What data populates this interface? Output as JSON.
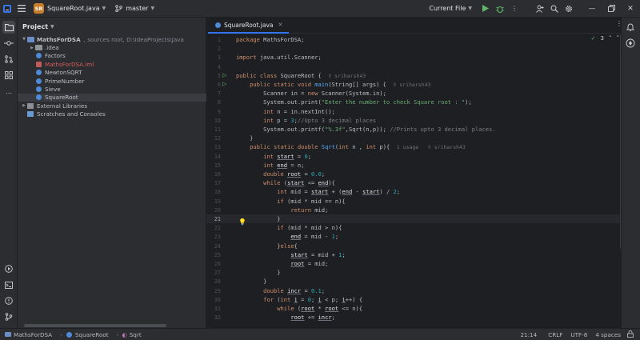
{
  "titlebar": {
    "project_badge": "SR",
    "file": "SquareRoot.java",
    "branch": "master",
    "run_config": "Current File"
  },
  "project_panel": {
    "title": "Project",
    "tree": [
      {
        "label": "MathsForDSA",
        "detail": "MathsForDSA,  sources root,  D:\\IdeaProjects\\Java",
        "type": "module",
        "indent": 1,
        "expanded": true
      },
      {
        "label": ".idea",
        "type": "folder",
        "indent": 2,
        "expanded": false
      },
      {
        "label": "Factors",
        "type": "class",
        "indent": 2
      },
      {
        "label": "MathsForDSA.iml",
        "type": "iml",
        "indent": 2
      },
      {
        "label": "NewtonSQRT",
        "type": "class",
        "indent": 2
      },
      {
        "label": "PrimeNumber",
        "type": "class",
        "indent": 2
      },
      {
        "label": "Sieve",
        "type": "class",
        "indent": 2
      },
      {
        "label": "SquareRoot",
        "type": "class",
        "indent": 2,
        "selected": true
      },
      {
        "label": "External Libraries",
        "type": "lib",
        "indent": 1,
        "expanded": false
      },
      {
        "label": "Scratches and Consoles",
        "type": "scratch",
        "indent": 1
      }
    ]
  },
  "editor": {
    "tab_label": "SquareRoot.java",
    "inspection_count": "3",
    "current_line": 21,
    "lines": [
      {
        "n": "1",
        "html": "<span class='kw'>package</span> MathsForDSA;"
      },
      {
        "n": "2",
        "html": ""
      },
      {
        "n": "3",
        "html": "<span class='kw'>import</span> java.util.Scanner;"
      },
      {
        "n": "4",
        "html": ""
      },
      {
        "n": "5",
        "html": "<span class='kw'>public class</span> SquareRoot {  <span class='hint'>♀ sriharsh43</span>",
        "run": true
      },
      {
        "n": "6",
        "html": "    <span class='kw'>public static void</span> <span class='fn'>main</span>(String[] args) {  <span class='hint'>♀ sriharsh43</span>",
        "run": true
      },
      {
        "n": "7",
        "html": "        Scanner in = <span class='kw'>new</span> Scanner(System.in);"
      },
      {
        "n": "8",
        "html": "        System.out.print(<span class='str'>\"Enter the number to check Square root : \"</span>);"
      },
      {
        "n": "9",
        "html": "        <span class='kw'>int</span> n = in.nextInt();"
      },
      {
        "n": "10",
        "html": "        <span class='kw'>int</span> p = <span class='num'>3</span>;<span class='cm'>//Upto 3 decimal places</span>"
      },
      {
        "n": "11",
        "html": "        System.out.printf(<span class='str'>\"%.3f\"</span>,Sqrt(n,p)); <span class='cm'>//Prints upto 3 decimal places.</span>"
      },
      {
        "n": "12",
        "html": "    }"
      },
      {
        "n": "13",
        "html": "    <span class='kw'>public static double</span> <span class='fn'>Sqrt</span>(<span class='kw'>int</span> n , <span class='kw'>int</span> p){  <span class='hint'>1 usage   ♀ sriharsh43</span>"
      },
      {
        "n": "14",
        "html": "        <span class='kw'>int</span> <span class='var'>start</span> = <span class='num'>0</span>;"
      },
      {
        "n": "15",
        "html": "        <span class='kw'>int</span> <span class='var'>end</span> = n;"
      },
      {
        "n": "16",
        "html": "        <span class='kw'>double</span> <span class='var'>root</span> = <span class='num'>0.0</span>;"
      },
      {
        "n": "17",
        "html": "        <span class='kw'>while</span> (<span class='var'>start</span> &lt;= <span class='var'>end</span>){"
      },
      {
        "n": "18",
        "html": "            <span class='kw'>int</span> mid = <span class='var'>start</span> + (<span class='var'>end</span> - <span class='var'>start</span>) / <span class='num'>2</span>;"
      },
      {
        "n": "19",
        "html": "            <span class='kw'>if</span> (mid * mid == n){"
      },
      {
        "n": "20",
        "html": "                <span class='kw'>return</span> mid;"
      },
      {
        "n": "21",
        "html": "            }"
      },
      {
        "n": "22",
        "html": "            <span class='kw'>if</span> (mid * mid &gt; n){"
      },
      {
        "n": "23",
        "html": "                <span class='var'>end</span> = mid - <span class='num'>1</span>;"
      },
      {
        "n": "24",
        "html": "            }<span class='kw'>else</span>{"
      },
      {
        "n": "25",
        "html": "                <span class='var'>start</span> = mid + <span class='num'>1</span>;"
      },
      {
        "n": "26",
        "html": "                <span class='var'>root</span> = mid;"
      },
      {
        "n": "27",
        "html": "            }"
      },
      {
        "n": "28",
        "html": "        }"
      },
      {
        "n": "29",
        "html": "        <span class='kw'>double</span> <span class='var'>incr</span> = <span class='num'>0.1</span>;"
      },
      {
        "n": "30",
        "html": "        <span class='kw'>for</span> (<span class='kw'>int</span> <span class='var'>i</span> = <span class='num'>0</span>; <span class='var'>i</span> &lt; p; <span class='var'>i</span>++) {"
      },
      {
        "n": "31",
        "html": "            <span class='kw'>while</span> (<span class='var'>root</span> * <span class='var'>root</span> &lt;= n){"
      },
      {
        "n": "32",
        "html": "                <span class='var'>root</span> += <span class='var'>incr</span>;"
      }
    ]
  },
  "statusbar": {
    "breadcrumbs": [
      "MathsForDSA",
      "SquareRoot",
      "Sqrt"
    ],
    "position": "21:14",
    "line_sep": "CRLF",
    "encoding": "UTF-8",
    "indent": "4 spaces"
  },
  "colors": {
    "accent": "#3574f0",
    "project_badge": "#c77d29",
    "run_green": "#5fb865"
  }
}
